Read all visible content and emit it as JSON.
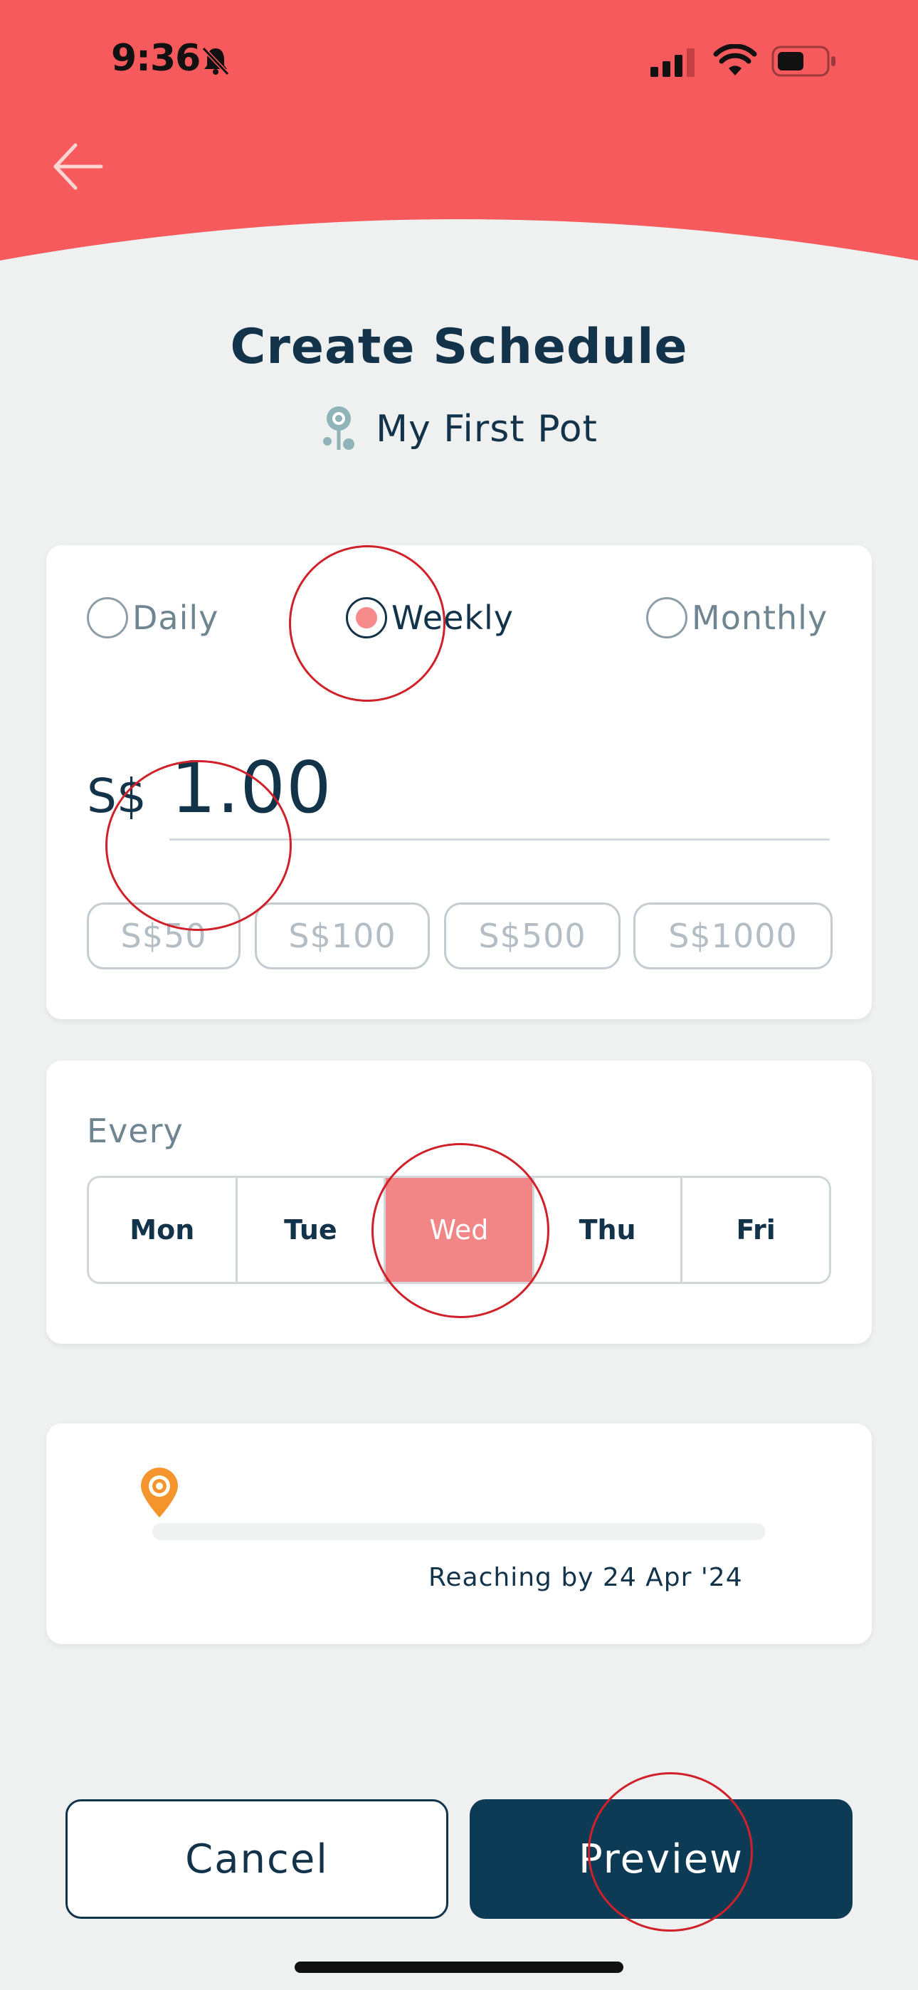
{
  "status_bar": {
    "time": "9:36"
  },
  "header": {
    "back_label": "Back",
    "color": "#f65a5c"
  },
  "title": "Create Schedule",
  "pot": {
    "name": "My First Pot",
    "icon": "pot-icon"
  },
  "frequency": {
    "options": [
      {
        "label": "Daily",
        "selected": false
      },
      {
        "label": "Weekly",
        "selected": true
      },
      {
        "label": "Monthly",
        "selected": false
      }
    ]
  },
  "amount": {
    "currency": "S$",
    "value": "1.00",
    "presets": [
      "S$50",
      "S$100",
      "S$500",
      "S$1000"
    ]
  },
  "schedule": {
    "every_label": "Every",
    "days": [
      {
        "label": "Mon",
        "selected": false
      },
      {
        "label": "Tue",
        "selected": false
      },
      {
        "label": "Wed",
        "selected": true
      },
      {
        "label": "Thu",
        "selected": false
      },
      {
        "label": "Fri",
        "selected": false
      }
    ]
  },
  "target": {
    "reaching_text": "Reaching by 24 Apr '24",
    "progress": 0
  },
  "buttons": {
    "cancel": "Cancel",
    "preview": "Preview"
  },
  "colors": {
    "accent": "#f65a5c",
    "selected_day": "#f28585",
    "primary": "#0d3a55",
    "text": "#12334a",
    "pin": "#f3952c"
  }
}
